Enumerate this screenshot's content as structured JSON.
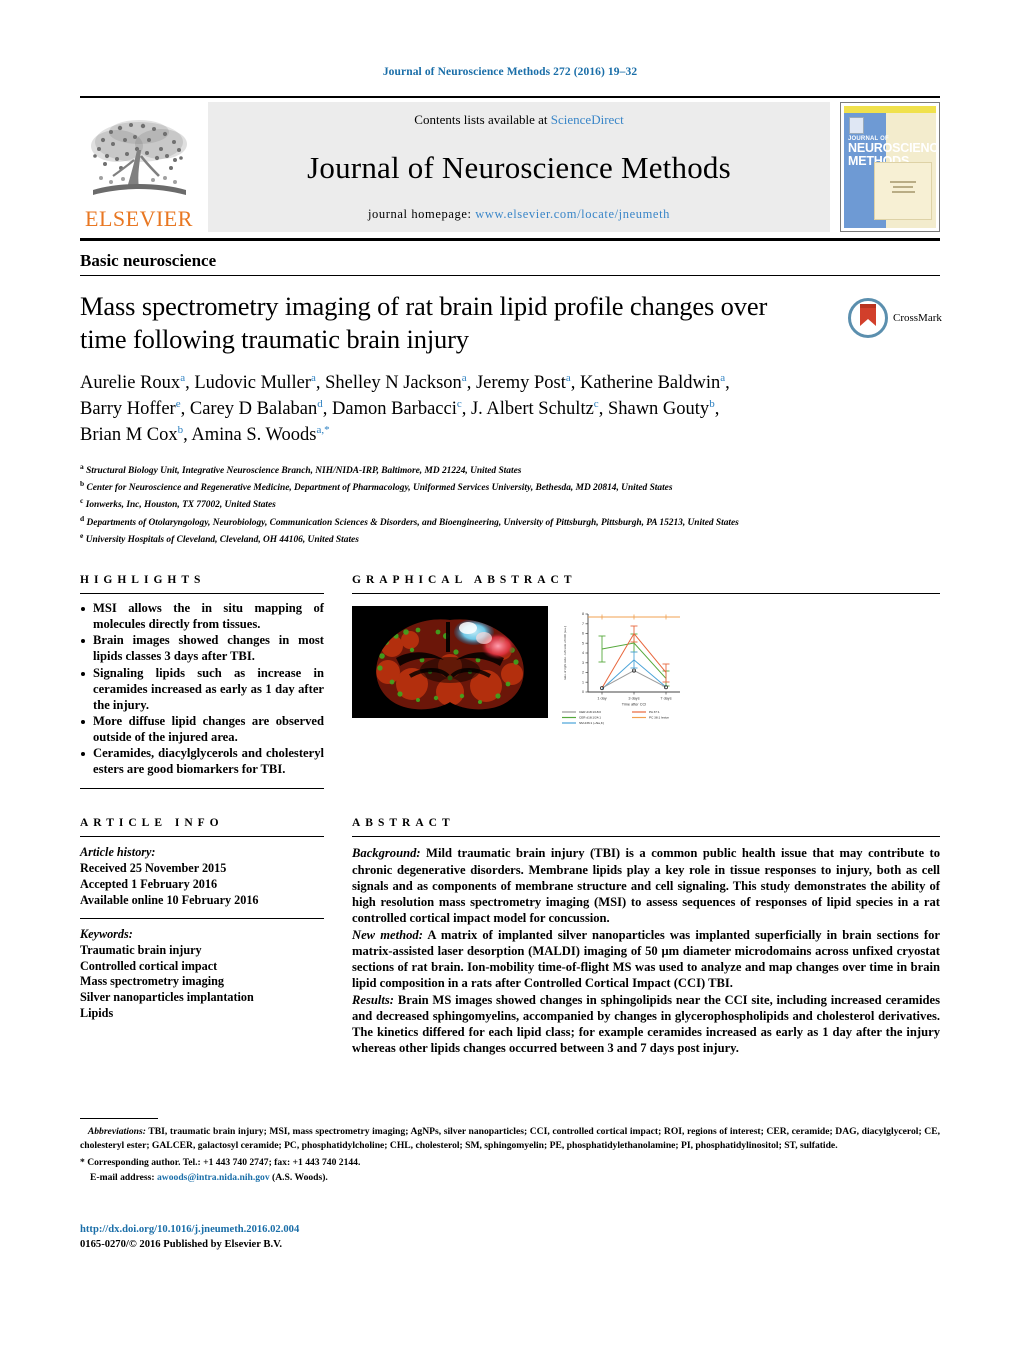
{
  "running_head": "Journal of Neuroscience Methods 272 (2016) 19–32",
  "masthead": {
    "contents_prefix": "Contents lists available at ",
    "sciencedirect": "ScienceDirect",
    "journal_title": "Journal of Neuroscience Methods",
    "homepage_prefix": "journal homepage: ",
    "homepage_url": "www.elsevier.com/locate/jneumeth",
    "publisher_logo_text": "ELSEVIER",
    "cover": {
      "line1": "JOURNAL OF",
      "line2": "NEUROSCIENCE",
      "line3": "METHODS"
    },
    "colors": {
      "link": "#3a86c8",
      "elsevier_orange": "#E87722",
      "cover_blue": "#6e9ad4",
      "cover_yellow": "#f0e14c"
    }
  },
  "article": {
    "section_kind": "Basic neuroscience",
    "title": "Mass spectrometry imaging of rat brain lipid profile changes over time following traumatic brain injury",
    "crossmark_label": "CrossMark",
    "authors": [
      {
        "name": "Aurelie Roux",
        "marks": "a",
        "sep": ", "
      },
      {
        "name": "Ludovic Muller",
        "marks": "a",
        "sep": ", "
      },
      {
        "name": "Shelley N Jackson",
        "marks": "a",
        "sep": ", "
      },
      {
        "name": "Jeremy Post",
        "marks": "a",
        "sep": ", "
      },
      {
        "name": "Katherine Baldwin",
        "marks": "a",
        "sep": ", "
      },
      {
        "name": "Barry Hoffer",
        "marks": "e",
        "sep": ", "
      },
      {
        "name": "Carey D Balaban",
        "marks": "d",
        "sep": ", "
      },
      {
        "name": "Damon Barbacci",
        "marks": "c",
        "sep": ", "
      },
      {
        "name": "J. Albert Schultz",
        "marks": "c",
        "sep": ", "
      },
      {
        "name": "Shawn Gouty",
        "marks": "b",
        "sep": ", "
      },
      {
        "name": "Brian M Cox",
        "marks": "b",
        "sep": ", "
      },
      {
        "name": "Amina S. Woods",
        "marks": "a,*",
        "sep": ""
      }
    ],
    "affiliations": [
      {
        "mark": "a",
        "text": "Structural Biology Unit, Integrative Neuroscience Branch, NIH/NIDA-IRP, Baltimore, MD 21224, United States"
      },
      {
        "mark": "b",
        "text": "Center for Neuroscience and Regenerative Medicine, Department of Pharmacology, Uniformed Services University, Bethesda, MD 20814, United States"
      },
      {
        "mark": "c",
        "text": "Ionwerks, Inc, Houston, TX 77002, United States"
      },
      {
        "mark": "d",
        "text": "Departments of Otolaryngology, Neurobiology, Communication Sciences & Disorders, and Bioengineering, University of Pittsburgh, Pittsburgh, PA 15213, United States"
      },
      {
        "mark": "e",
        "text": "University Hospitals of Cleveland, Cleveland, OH 44106, United States"
      }
    ]
  },
  "highlights": {
    "header": "HIGHLIGHTS",
    "items": [
      "MSI allows the in situ mapping of molecules directly from tissues.",
      "Brain images showed changes in most lipids classes 3 days after TBI.",
      "Signaling lipids such as increase in ceramides increased as early as 1 day after the injury.",
      "More diffuse lipid changes are observed outside of the injured area.",
      "Ceramides, diacylglycerols and cholesteryl esters are good biomarkers for TBI."
    ]
  },
  "graphical_abstract": {
    "header": "GRAPHICAL ABSTRACT"
  },
  "chart_data": {
    "type": "line",
    "title": "",
    "xlabel": "Time after CCI",
    "ylabel": "Ratio of right side / left side (lesion/contralateral)",
    "categories": [
      "1 day",
      "3 days",
      "7 days"
    ],
    "x": [
      "1 day",
      "3 days",
      "7 days"
    ],
    "ylim": [
      0,
      8
    ],
    "grid": false,
    "legend_position": "bottom",
    "series": [
      {
        "name": "CER d18:1/18:0",
        "color": "#9a9a9a",
        "values": [
          0.4,
          2.2,
          0.5
        ]
      },
      {
        "name": "CER d18:1/24:1",
        "color": "#56a83c",
        "values": [
          4.4,
          5.0,
          1.4
        ]
      },
      {
        "name": "SM d36:1 (+Na,K)",
        "color": "#4aa3d8",
        "values": [
          0.3,
          3.3,
          0.5
        ]
      },
      {
        "name": "PA 37:1",
        "color": "#e8663c",
        "values": [
          0.4,
          6.0,
          2.0
        ]
      },
      {
        "name": "PC 38:1 lesion",
        "color": "#f0a050",
        "values": [
          7.7,
          7.7,
          7.7
        ]
      }
    ]
  },
  "article_info": {
    "header": "ARTICLE INFO",
    "history_label": "Article history:",
    "history": [
      "Received 25 November 2015",
      "Accepted 1 February 2016",
      "Available online 10 February 2016"
    ],
    "keywords_label": "Keywords:",
    "keywords": [
      "Traumatic brain injury",
      "Controlled cortical impact",
      "Mass spectrometry imaging",
      "Silver nanoparticles implantation",
      "Lipids"
    ]
  },
  "abstract": {
    "header": "ABSTRACT",
    "paragraphs": [
      {
        "lead": "Background:",
        "text": " Mild traumatic brain injury (TBI) is a common public health issue that may contribute to chronic degenerative disorders. Membrane lipids play a key role in tissue responses to injury, both as cell signals and as components of membrane structure and cell signaling. This study demonstrates the ability of high resolution mass spectrometry imaging (MSI) to assess sequences of responses of lipid species in a rat controlled cortical impact model for concussion."
      },
      {
        "lead": "New method:",
        "text": " A matrix of implanted silver nanoparticles was implanted superficially in brain sections for matrix-assisted laser desorption (MALDI) imaging of 50 μm diameter microdomains across unfixed cryostat sections of rat brain. Ion-mobility time-of-flight MS was used to analyze and map changes over time in brain lipid composition in a rats after Controlled Cortical Impact (CCI) TBI."
      },
      {
        "lead": "Results:",
        "text": " Brain MS images showed changes in sphingolipids near the CCI site, including increased ceramides and decreased sphingomyelins, accompanied by changes in glycerophospholipids and cholesterol derivatives. The kinetics differed for each lipid class; for example ceramides increased as early as 1 day after the injury whereas other lipids changes occurred between 3 and 7 days post injury."
      }
    ]
  },
  "footnotes": {
    "abbreviations_label": "Abbreviations:",
    "abbreviations_text": " TBI, traumatic brain injury; MSI, mass spectrometry imaging; AgNPs, silver nanoparticles; CCI, controlled cortical impact; ROI, regions of interest; CER, ceramide; DAG, diacylglycerol; CE, cholesteryl ester; GALCER, galactosyl ceramide; PC, phosphatidylcholine; CHL, cholesterol; SM, sphingomyelin; PE, phosphatidylethanolamine; PI, phosphatidylinositol; ST, sulfatide.",
    "corresponding": "* Corresponding author. Tel.: +1 443 740 2747; fax: +1 443 740 2144.",
    "email_label": "E-mail address:",
    "email": "awoods@intra.nida.nih.gov",
    "email_suffix": " (A.S. Woods)."
  },
  "footer": {
    "doi": "http://dx.doi.org/10.1016/j.jneumeth.2016.02.004",
    "copyright": "0165-0270/© 2016 Published by Elsevier B.V."
  }
}
